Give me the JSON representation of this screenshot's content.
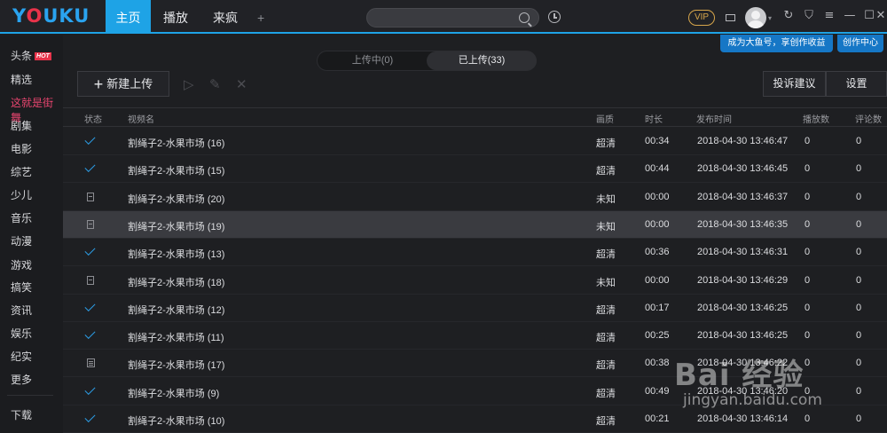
{
  "topbar": {
    "logo": "YOUKU",
    "tabs": [
      {
        "label": "主页",
        "active": true
      },
      {
        "label": "播放",
        "active": false
      },
      {
        "label": "来疯",
        "active": false
      }
    ],
    "add_tab": "+",
    "search": {
      "value": "",
      "placeholder": ""
    },
    "vip_label": "VIP",
    "window_controls": [
      "refresh-icon",
      "skin-icon",
      "menu-icon",
      "minimize-icon",
      "maximize-icon",
      "close-icon"
    ]
  },
  "ribbon": {
    "dayu_label": "成为大鱼号，享创作收益",
    "creator_center_label": "创作中心"
  },
  "sidebar": {
    "items": [
      {
        "label": "头条",
        "badge": "HOT"
      },
      {
        "label": "精选"
      },
      {
        "label": "这就是街舞",
        "highlight": true
      },
      {
        "label": "剧集"
      },
      {
        "label": "电影"
      },
      {
        "label": "综艺"
      },
      {
        "label": "少儿"
      },
      {
        "label": "音乐"
      },
      {
        "label": "动漫"
      },
      {
        "label": "游戏"
      },
      {
        "label": "搞笑"
      },
      {
        "label": "资讯"
      },
      {
        "label": "娱乐"
      },
      {
        "label": "纪实"
      },
      {
        "label": "更多"
      }
    ],
    "download_label": "下载"
  },
  "segment": {
    "uploading": "上传中(0)",
    "uploaded": "已上传(33)"
  },
  "toolbar": {
    "new_upload": "新建上传",
    "new_upload_icon": "+",
    "complaint": "投诉建议",
    "settings": "设置"
  },
  "table": {
    "headers": {
      "status": "状态",
      "name": "视频名",
      "quality": "画质",
      "duration": "时长",
      "publish_time": "发布时间",
      "plays": "播放数",
      "comments": "评论数"
    },
    "rows": [
      {
        "status": "check",
        "name": "割绳子2-水果市场 (16)",
        "quality": "超清",
        "duration": "00:34",
        "publish_time": "2018-04-30 13:46:47",
        "plays": "0",
        "comments": "0"
      },
      {
        "status": "check",
        "name": "割绳子2-水果市场 (15)",
        "quality": "超清",
        "duration": "00:44",
        "publish_time": "2018-04-30 13:46:45",
        "plays": "0",
        "comments": "0"
      },
      {
        "status": "doc",
        "name": "割绳子2-水果市场 (20)",
        "quality": "未知",
        "duration": "00:00",
        "publish_time": "2018-04-30 13:46:37",
        "plays": "0",
        "comments": "0"
      },
      {
        "status": "doc",
        "name": "割绳子2-水果市场 (19)",
        "quality": "未知",
        "duration": "00:00",
        "publish_time": "2018-04-30 13:46:35",
        "plays": "0",
        "comments": "0",
        "highlight": true
      },
      {
        "status": "check",
        "name": "割绳子2-水果市场 (13)",
        "quality": "超清",
        "duration": "00:36",
        "publish_time": "2018-04-30 13:46:31",
        "plays": "0",
        "comments": "0"
      },
      {
        "status": "doc",
        "name": "割绳子2-水果市场 (18)",
        "quality": "未知",
        "duration": "00:00",
        "publish_time": "2018-04-30 13:46:29",
        "plays": "0",
        "comments": "0"
      },
      {
        "status": "check",
        "name": "割绳子2-水果市场 (12)",
        "quality": "超清",
        "duration": "00:17",
        "publish_time": "2018-04-30 13:46:25",
        "plays": "0",
        "comments": "0"
      },
      {
        "status": "check",
        "name": "割绳子2-水果市场 (11)",
        "quality": "超清",
        "duration": "00:25",
        "publish_time": "2018-04-30 13:46:25",
        "plays": "0",
        "comments": "0"
      },
      {
        "status": "pend",
        "name": "割绳子2-水果市场 (17)",
        "quality": "超清",
        "duration": "00:38",
        "publish_time": "2018-04-30 13:46:22",
        "plays": "0",
        "comments": "0"
      },
      {
        "status": "check",
        "name": "割绳子2-水果市场 (9)",
        "quality": "超清",
        "duration": "00:49",
        "publish_time": "2018-04-30 13:46:20",
        "plays": "0",
        "comments": "0"
      },
      {
        "status": "check",
        "name": "割绳子2-水果市场 (10)",
        "quality": "超清",
        "duration": "00:21",
        "publish_time": "2018-04-30 13:46:14",
        "plays": "0",
        "comments": "0"
      }
    ]
  },
  "watermark": {
    "text": "Bai 经验",
    "url": "jingyan.baidu.com"
  },
  "colors": {
    "accent": "#1ea3e6",
    "ribbon": "#1677c6",
    "highlight_text": "#e8456f",
    "background": "#1e1f22"
  }
}
